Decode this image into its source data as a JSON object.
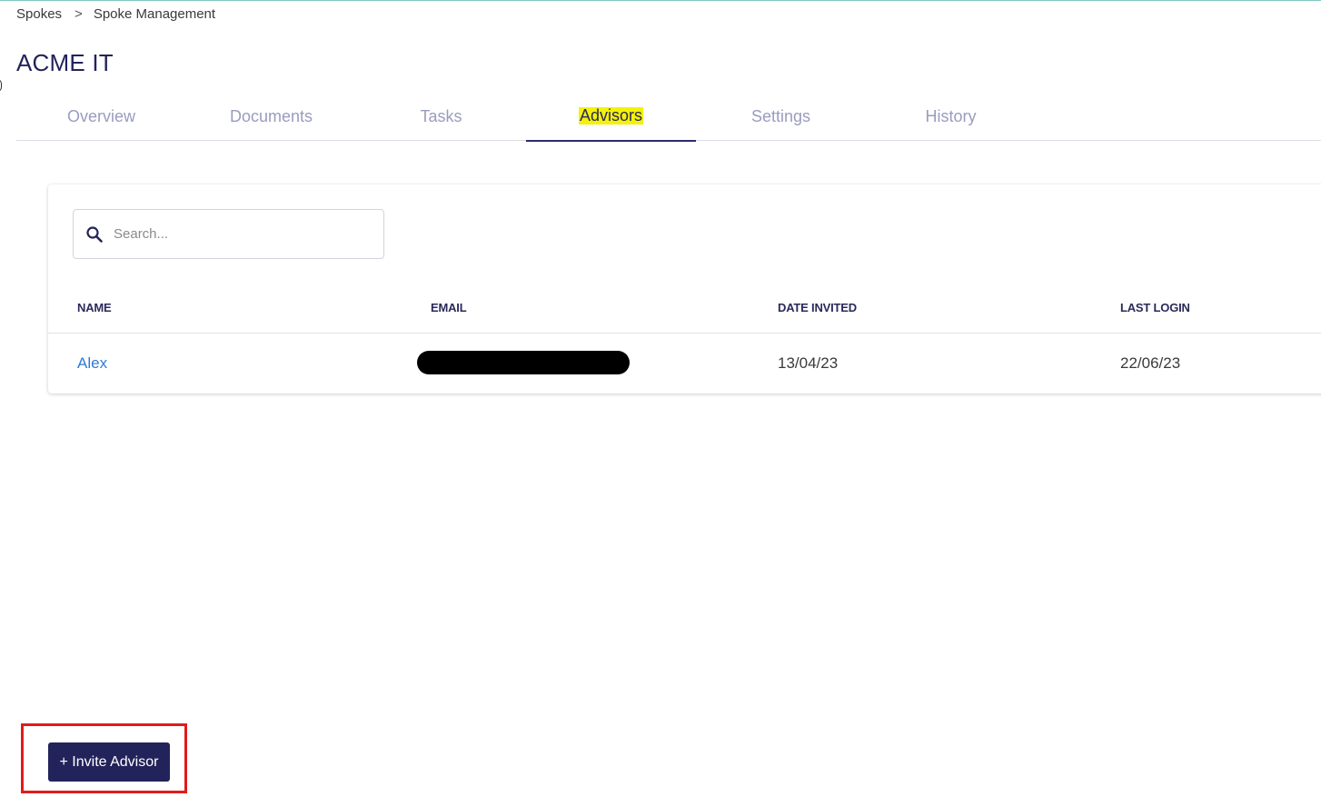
{
  "breadcrumb": {
    "items": [
      "Spokes",
      "Spoke Management"
    ],
    "separator": ">"
  },
  "page": {
    "title": "ACME IT"
  },
  "tabs": [
    {
      "label": "Overview",
      "active": false
    },
    {
      "label": "Documents",
      "active": false
    },
    {
      "label": "Tasks",
      "active": false
    },
    {
      "label": "Advisors",
      "active": true
    },
    {
      "label": "Settings",
      "active": false
    },
    {
      "label": "History",
      "active": false
    }
  ],
  "search": {
    "placeholder": "Search...",
    "value": "",
    "icon": "search-icon"
  },
  "table": {
    "columns": [
      "NAME",
      "EMAIL",
      "DATE INVITED",
      "LAST LOGIN"
    ],
    "rows": [
      {
        "name": "Alex",
        "email": "",
        "date_invited": "13/04/23",
        "last_login": "22/06/23"
      }
    ]
  },
  "actions": {
    "invite_label": "+ Invite Advisor"
  },
  "colors": {
    "primary": "#23235b",
    "link": "#2f7bd6",
    "tab_inactive": "#9a9cbf",
    "active_highlight": "#f4f10a",
    "annotation_frame": "#e01b1b"
  }
}
